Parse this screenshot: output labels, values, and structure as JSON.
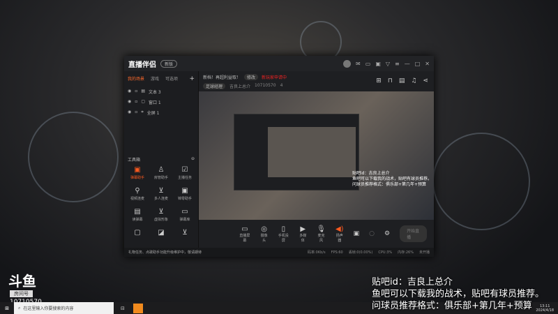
{
  "app": {
    "name": "直播伴侣",
    "version": "新版"
  },
  "layer_tabs": [
    "我的场景",
    "游戏",
    "可选项"
  ],
  "layers": [
    {
      "icon": "text-icon",
      "label": "文本 3"
    },
    {
      "icon": "window-icon",
      "label": "窗口 1"
    },
    {
      "icon": "fullscreen-icon",
      "label": "全屏 1"
    }
  ],
  "toolbox": {
    "title": "工具箱",
    "tools": [
      "弹幕助手",
      "房管助手",
      "主播任务",
      "视频连麦",
      "多人连麦",
      "锦零助手",
      "读弹幕",
      "虚拟形象",
      "弹幕库",
      "",
      "",
      ""
    ]
  },
  "header": {
    "title": "新档！再超利益取！",
    "edit": "修改",
    "notice": "新玩家申请中",
    "category": "足球经理",
    "host": "吉良上总介",
    "room_id": "10710570",
    "hot": "4"
  },
  "danmu": [
    "贴吧id：吉良上总介",
    "鱼吧可以下载我的战术，贴吧有球员推荐。",
    "问球员推荐格式：俱乐部+第几年+预算"
  ],
  "controls": [
    "直播屏幕",
    "摄像头",
    "手机投屏",
    "多媒体",
    "麦克风",
    "扬声器"
  ],
  "start_button": "开始直播",
  "status": {
    "tip": "礼物任务、点歌助手功能升级维护中，敬请期待",
    "bitrate": "码率:0Kb/s",
    "fps": "FPS:60",
    "dropped": "丢帧:0(0.00%)",
    "cpu": "CPU:3%",
    "mem": "内存:26%",
    "live": "未开播"
  },
  "overlay": [
    "贴吧id：吉良上总介",
    "鱼吧可以下载我的战术，贴吧有球员推荐。",
    "问球员推荐格式：俱乐部+第几年+预算"
  ],
  "brand": {
    "logo": "斗鱼",
    "room_label": "房间号",
    "room_id": "10710570"
  },
  "taskbar": {
    "search_placeholder": "在这里输入你要搜索的内容",
    "time": "13:11",
    "date": "2024/4/18"
  },
  "colors": {
    "accent": "#ff5a1f"
  }
}
